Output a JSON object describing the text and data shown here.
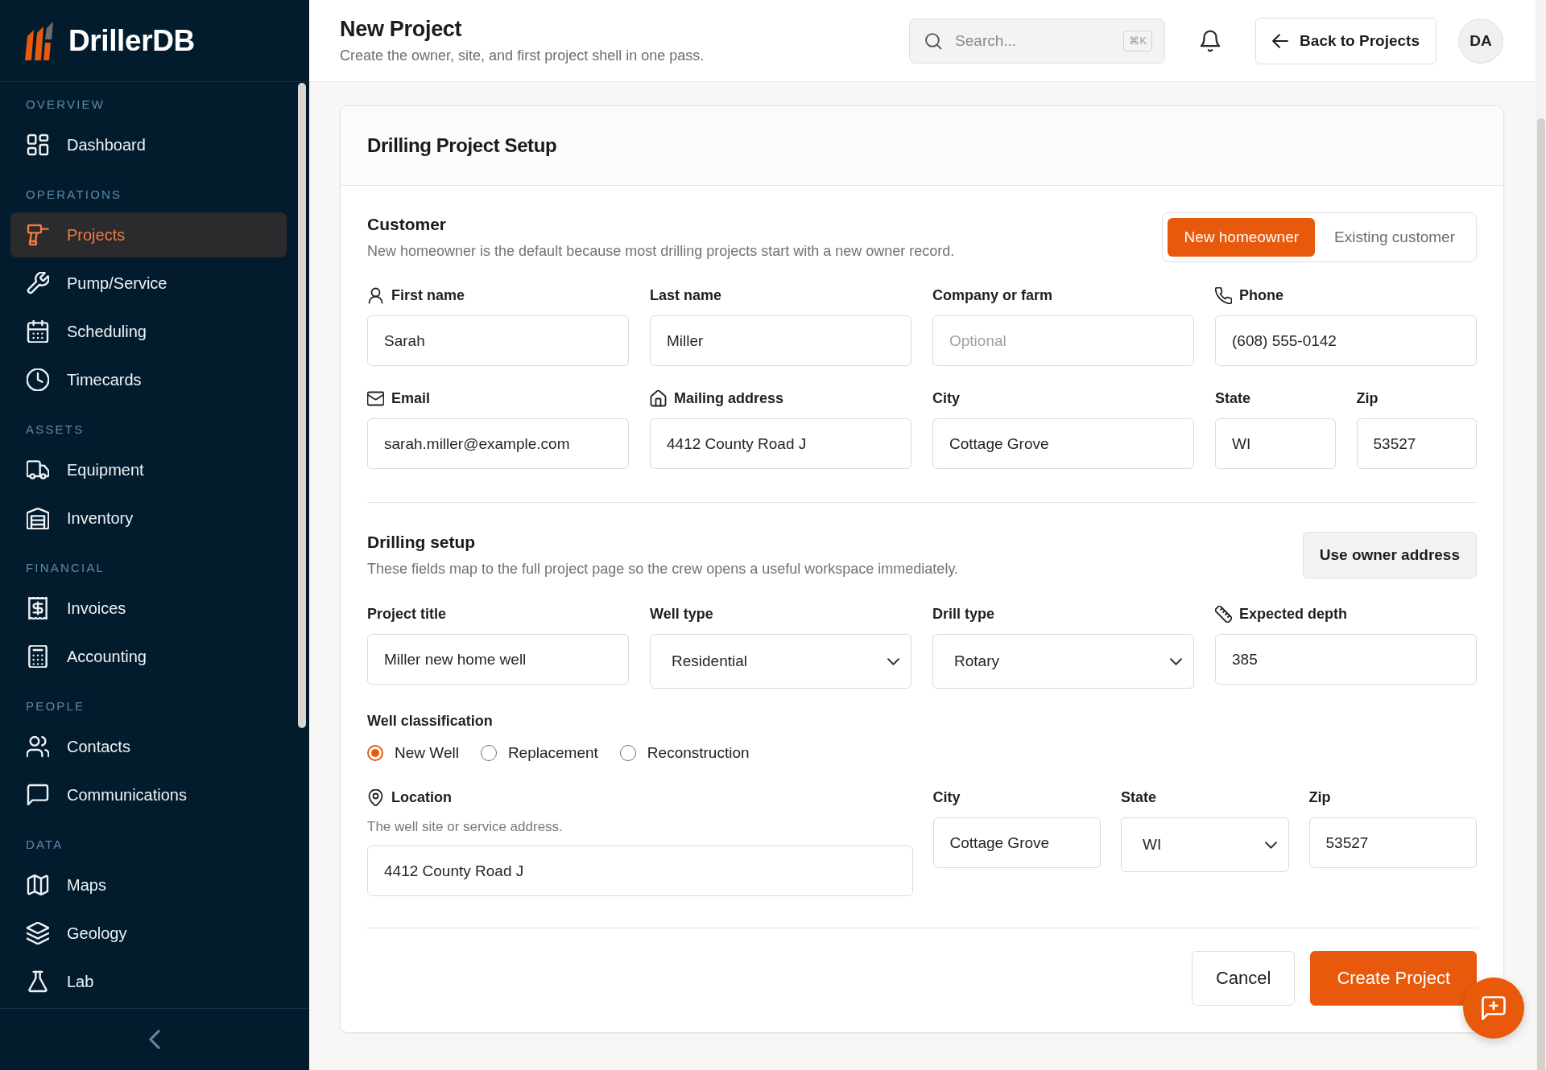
{
  "sidebar": {
    "brand": "DrillerDB",
    "sections": [
      {
        "label": "OVERVIEW",
        "items": [
          {
            "label": "Dashboard",
            "selected": false
          }
        ]
      },
      {
        "label": "OPERATIONS",
        "items": [
          {
            "label": "Projects",
            "selected": true
          },
          {
            "label": "Pump/Service",
            "selected": false
          },
          {
            "label": "Scheduling",
            "selected": false
          },
          {
            "label": "Timecards",
            "selected": false
          }
        ]
      },
      {
        "label": "ASSETS",
        "items": [
          {
            "label": "Equipment",
            "selected": false
          },
          {
            "label": "Inventory",
            "selected": false
          }
        ]
      },
      {
        "label": "FINANCIAL",
        "items": [
          {
            "label": "Invoices",
            "selected": false
          },
          {
            "label": "Accounting",
            "selected": false
          }
        ]
      },
      {
        "label": "PEOPLE",
        "items": [
          {
            "label": "Contacts",
            "selected": false
          },
          {
            "label": "Communications",
            "selected": false
          }
        ]
      },
      {
        "label": "DATA",
        "items": [
          {
            "label": "Maps",
            "selected": false
          },
          {
            "label": "Geology",
            "selected": false
          },
          {
            "label": "Lab",
            "selected": false
          }
        ]
      }
    ]
  },
  "header": {
    "title": "New Project",
    "subtitle": "Create the owner, site, and first project shell in one pass.",
    "search": {
      "placeholder": "Search...",
      "shortcut": "⌘K"
    },
    "back_button": "Back to Projects",
    "avatar": "DA"
  },
  "card": {
    "title": "Drilling Project Setup",
    "customer": {
      "title": "Customer",
      "description": "New homeowner is the default because most drilling projects start with a new owner record.",
      "toggle": [
        {
          "label": "New homeowner",
          "selected": true
        },
        {
          "label": "Existing customer",
          "selected": false
        }
      ],
      "rows": [
        [
          {
            "label": "First name",
            "kind": "text",
            "value": "Sarah"
          },
          {
            "label": "Last name",
            "kind": "text",
            "value": "Miller"
          },
          {
            "label": "Company or farm",
            "kind": "text",
            "placeholder": "Optional"
          },
          {
            "label": "Phone",
            "kind": "text",
            "value": "(608) 555-0142"
          }
        ],
        [
          {
            "label": "Email",
            "kind": "text",
            "value": "sarah.miller@example.com"
          },
          {
            "label": "Mailing address",
            "kind": "text",
            "value": "4412 County Road J"
          },
          {
            "label": "City",
            "kind": "text",
            "value": "Cottage Grove"
          },
          {
            "label": "State",
            "kind": "text",
            "value": "WI"
          },
          {
            "label": "Zip",
            "kind": "text",
            "value": "53527"
          }
        ]
      ]
    },
    "drilling": {
      "title": "Drilling setup",
      "description": "These fields map to the full project page so the crew opens a useful workspace immediately.",
      "action": "Use owner address",
      "fields": [
        {
          "label": "Project title",
          "kind": "text",
          "value": "Miller new home well"
        },
        {
          "label": "Well type",
          "kind": "select",
          "value": "Residential"
        },
        {
          "label": "Drill type",
          "kind": "select",
          "value": "Rotary"
        },
        {
          "label": "Expected depth",
          "kind": "text",
          "value": "385"
        }
      ],
      "classification": {
        "label": "Well classification",
        "options": [
          {
            "label": "New Well",
            "selected": true
          },
          {
            "label": "Replacement",
            "selected": false
          },
          {
            "label": "Reconstruction",
            "selected": false
          }
        ]
      },
      "location": [
        {
          "label": "Location",
          "description": "The well site or service address.",
          "kind": "text",
          "value": "4412 County Road J"
        },
        {
          "label": "City",
          "kind": "text",
          "value": "Cottage Grove"
        },
        {
          "label": "State",
          "kind": "select",
          "value": "WI"
        },
        {
          "label": "Zip",
          "kind": "text",
          "value": "53527"
        }
      ]
    },
    "actions": [
      {
        "label": "Cancel",
        "kind": "secondary"
      },
      {
        "label": "Create Project",
        "kind": "primary"
      }
    ]
  }
}
